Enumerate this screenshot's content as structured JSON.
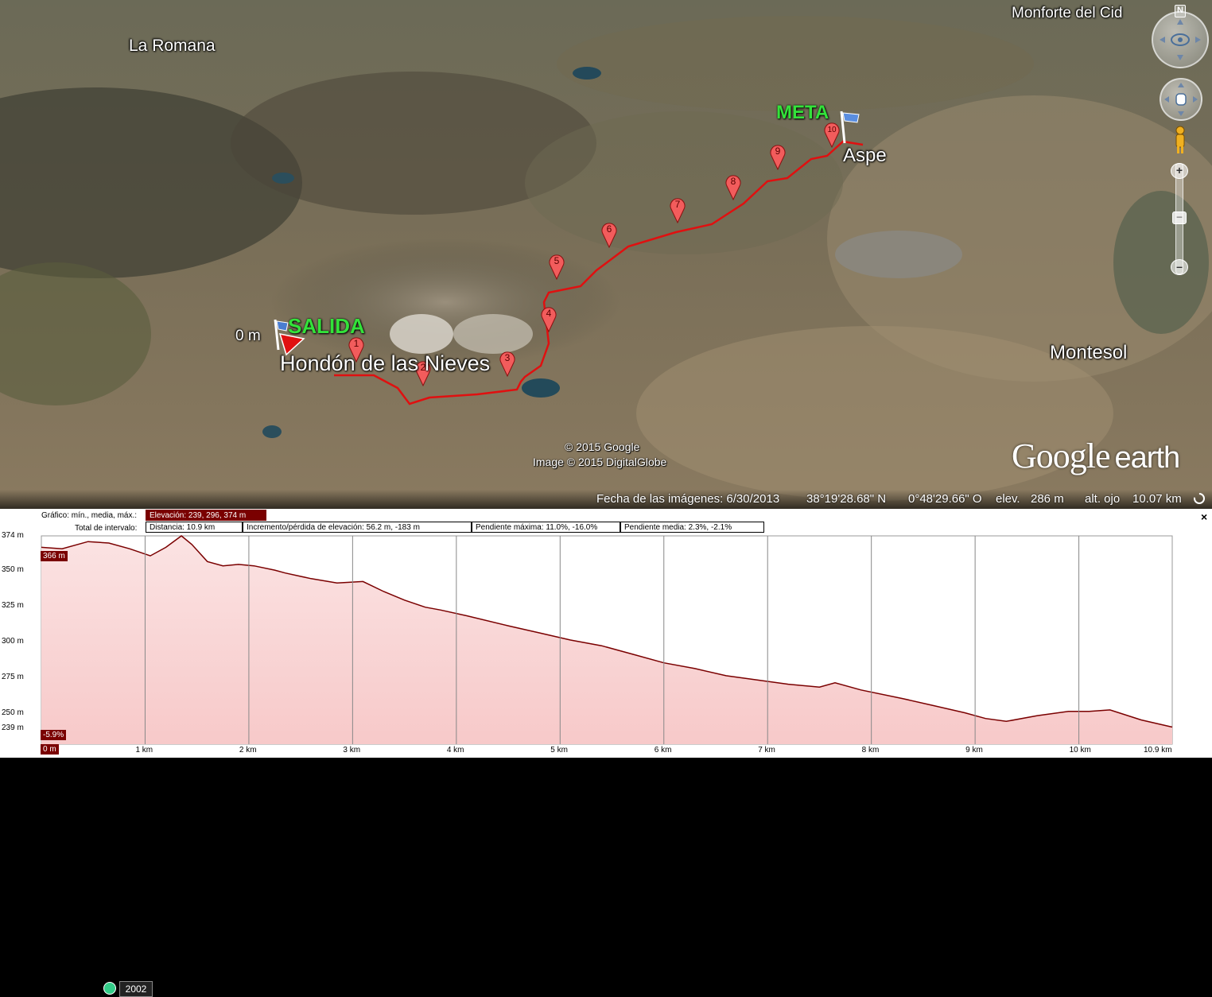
{
  "map": {
    "places": {
      "la_romana": "La Romana",
      "monforte": "Monforte del Cid",
      "aspe": "Aspe",
      "hondon": "Hondón de las Nieves",
      "montesol": "Montesol"
    },
    "start_label": "SALIDA",
    "end_label": "META",
    "start_elev_label": "0 m",
    "waypoints": [
      "1",
      "2",
      "3",
      "4",
      "5",
      "6",
      "7",
      "8",
      "9",
      "10"
    ],
    "copyright_1": "© 2015 Google",
    "copyright_2": "Image © 2015 DigitalGlobe",
    "logo_google": "Google",
    "logo_earth": "earth",
    "year_badge": "2002",
    "north_label": "N"
  },
  "statusbar": {
    "imagery_date": "Fecha de las imágenes: 6/30/2013",
    "lat": "38°19'28.68\" N",
    "lon": "0°48'29.66\" O",
    "elev_label": "elev.",
    "elev_value": "286 m",
    "eye_label": "alt. ojo",
    "eye_value": "10.07 km"
  },
  "profile": {
    "row1_label": "Gráfico: mín., media, máx.:",
    "elevation_box": "Elevación: 239, 296, 374 m",
    "row2_label": "Total de intervalo:",
    "distance_box": "Distancia: 10.9 km",
    "gain_box": "Incremento/pérdida de elevación: 56.2 m, -183 m",
    "max_slope_box": "Pendiente máxima: 11.0%, -16.0%",
    "avg_slope_box": "Pendiente media: 2.3%, -2.1%",
    "close_glyph": "×",
    "cursor_elev_tag": "366 m",
    "cursor_slope_tag": "-5.9%",
    "cursor_dist_tag": "0 m"
  },
  "colors": {
    "route": "#e01010",
    "profile_fill": "#f7c9c9",
    "profile_line": "#7a0000",
    "label_green": "#33e23a"
  },
  "chart_data": {
    "type": "area",
    "title": "",
    "xlabel": "",
    "ylabel": "",
    "x_ticks": [
      "1 km",
      "2 km",
      "3 km",
      "4 km",
      "5 km",
      "6 km",
      "7 km",
      "8 km",
      "9 km",
      "10 km",
      "10.9 km"
    ],
    "y_ticks": [
      "374 m",
      "350 m",
      "325 m",
      "300 m",
      "275 m",
      "250 m",
      "239 m"
    ],
    "xlim": [
      0,
      10.9
    ],
    "ylim": [
      228,
      374
    ],
    "grid": true,
    "series": [
      {
        "x": [
          0,
          0.2,
          0.45,
          0.65,
          0.85,
          1.05,
          1.2,
          1.35,
          1.45,
          1.6,
          1.75,
          1.9,
          2.05,
          2.25,
          2.35,
          2.6,
          2.85,
          3.1,
          3.3,
          3.5,
          3.7,
          3.85,
          4.1,
          4.5,
          4.8,
          5.1,
          5.4,
          5.7,
          6.0,
          6.3,
          6.6,
          6.9,
          7.2,
          7.5,
          7.65,
          7.9,
          8.3,
          8.6,
          8.9,
          9.1,
          9.3,
          9.6,
          9.9,
          10.1,
          10.3,
          10.6,
          10.9
        ],
        "values": [
          366,
          365,
          370,
          369,
          365,
          360,
          366,
          374,
          368,
          356,
          353,
          354,
          353,
          350,
          348,
          344,
          341,
          342,
          335,
          329,
          324,
          322,
          318,
          311,
          306,
          301,
          297,
          291,
          285,
          281,
          276,
          273,
          270,
          268,
          271,
          266,
          260,
          255,
          250,
          246,
          244,
          248,
          251,
          251,
          252,
          245,
          240
        ]
      }
    ]
  }
}
